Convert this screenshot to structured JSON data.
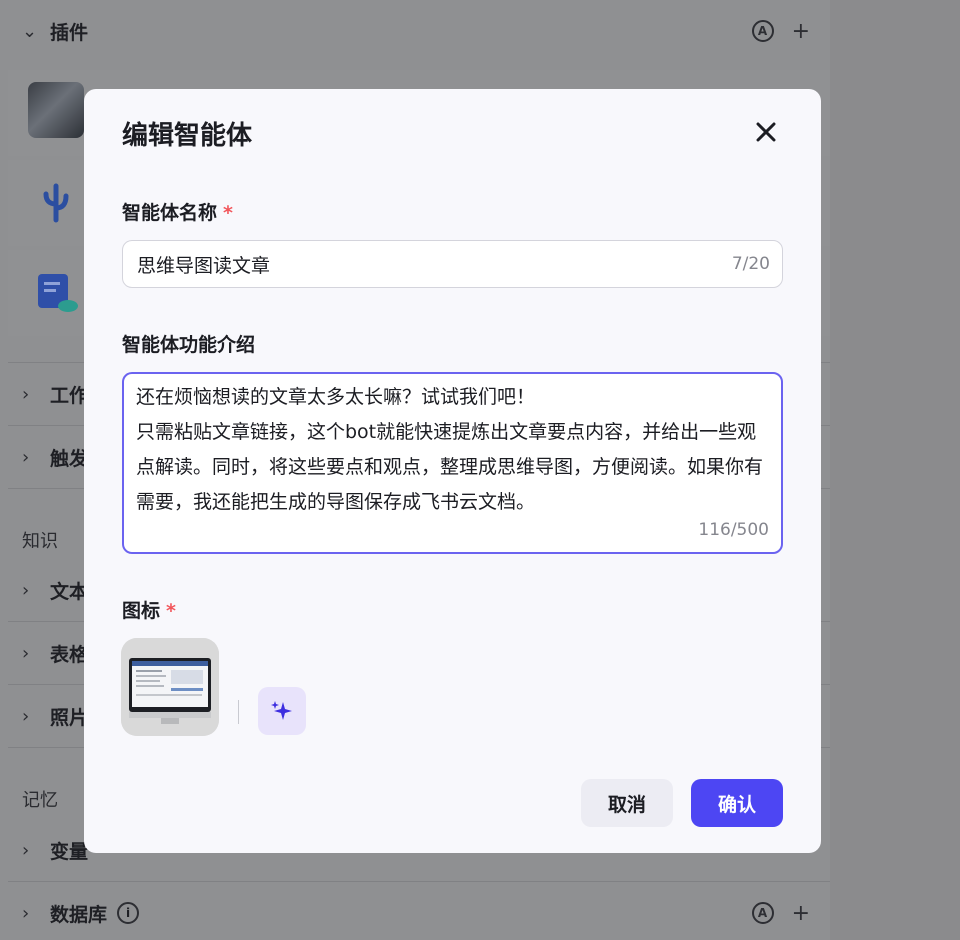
{
  "background": {
    "plugins_header": "插件",
    "plugin_items": [
      {
        "name_partial": ""
      },
      {
        "name_partial": ""
      },
      {
        "name_partial": ""
      }
    ],
    "rows": [
      {
        "label": "工作"
      },
      {
        "label": "触发"
      }
    ],
    "knowledge_section": "知识",
    "knowledge_rows": [
      {
        "label": "文本"
      },
      {
        "label": "表格"
      },
      {
        "label": "照片"
      }
    ],
    "memory_section": "记忆",
    "memory_rows": [
      {
        "label": "变量"
      },
      {
        "label": "数据库"
      }
    ]
  },
  "modal": {
    "title": "编辑智能体",
    "name_label": "智能体名称",
    "required_mark": "*",
    "name_value": "思维导图读文章",
    "name_counter": "7/20",
    "desc_label": "智能体功能介绍",
    "desc_value": "还在烦恼想读的文章太多太长嘛？试试我们吧！\n只需粘贴文章链接，这个bot就能快速提炼出文章要点内容，并给出一些观点解读。同时，将这些要点和观点，整理成思维导图，方便阅读。如果你有需要，我还能把生成的导图保存成飞书云文档。",
    "desc_counter": "116/500",
    "icon_label": "图标",
    "cancel_label": "取消",
    "confirm_label": "确认"
  },
  "colors": {
    "accent": "#4d46f3",
    "required": "#f2555a",
    "focus_border": "#6b63f0"
  }
}
